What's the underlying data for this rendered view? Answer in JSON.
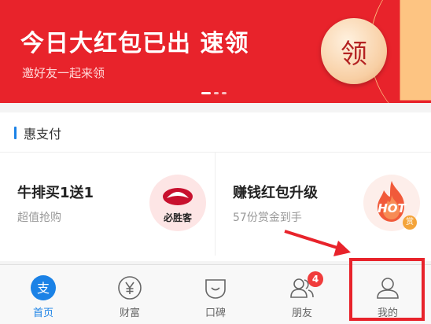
{
  "banner": {
    "title": "今日大红包已出 速领",
    "subtitle": "邀好友一起来领",
    "claim_label": "领"
  },
  "section": {
    "title": "惠支付",
    "cards": [
      {
        "title": "牛排买1送1",
        "subtitle": "超值抢购",
        "logo_text": "必胜客"
      },
      {
        "title": "赚钱红包升级",
        "subtitle": "57份赏金到手",
        "logo_text": "HOT",
        "badge": "赏"
      }
    ]
  },
  "tabbar": {
    "tabs": [
      {
        "label": "首页",
        "icon": "alipay-home-icon",
        "active": true
      },
      {
        "label": "财富",
        "icon": "yen-coin-icon"
      },
      {
        "label": "口碑",
        "icon": "koubei-icon"
      },
      {
        "label": "朋友",
        "icon": "friends-icon",
        "badge": "4"
      },
      {
        "label": "我的",
        "icon": "person-icon"
      }
    ]
  },
  "colors": {
    "brand_red": "#e8232b",
    "accent_blue": "#1b82e6",
    "annotation_red": "#e8232b"
  }
}
